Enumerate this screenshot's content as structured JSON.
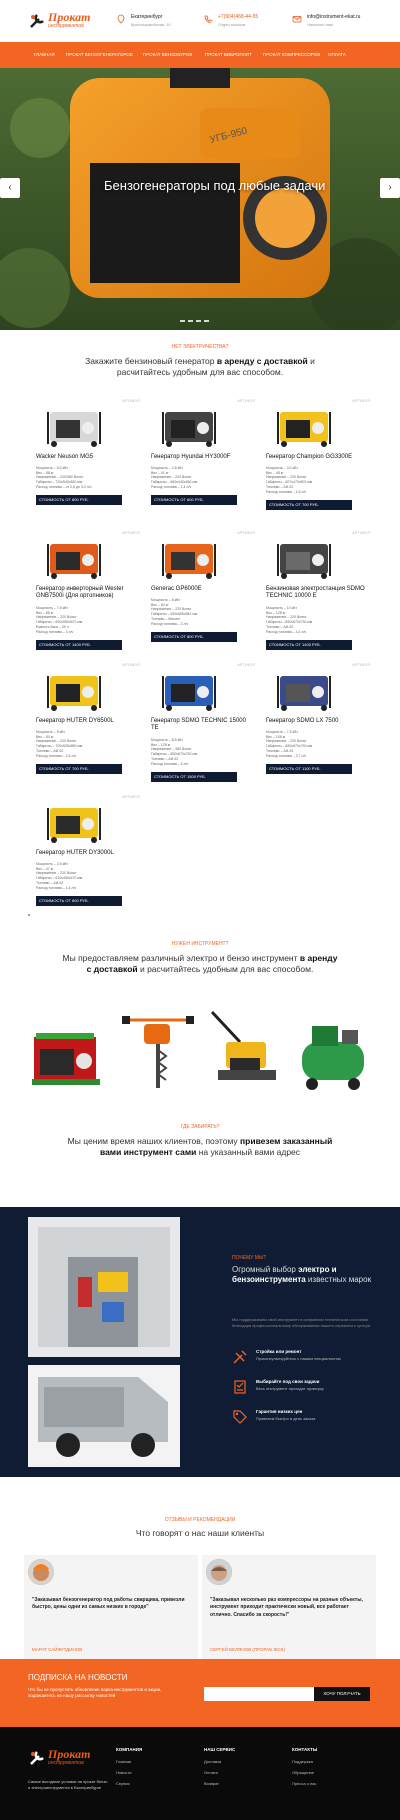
{
  "header": {
    "logo_title": "Прокат",
    "logo_subtitle": "инструментов",
    "address_city": "Екатеринбург",
    "address_street": "Красноармейская, 10",
    "phone": "+7(904)468-44-55",
    "phone_note": "Отдел заказов",
    "email": "info@instrument-ekat.ru",
    "email_note": "Написать нам"
  },
  "nav": [
    "Главная",
    "Прокат бензогенераторов",
    "Прокат бензобуров",
    "Прокат виброплит",
    "Прокат компрессоров",
    "Оплата"
  ],
  "hero": {
    "title": "Бензогенераторы под любые задачи",
    "slides": 4,
    "active_slide": 1,
    "prev_icon": "chevron-left-icon",
    "next_icon": "chevron-right-icon",
    "device_label": "УГБ-950"
  },
  "intro": {
    "eyebrow": "Нет электричества?",
    "title_pre": "Закажите бензиновый генератор ",
    "title_bold": "в аренду с доставкой",
    "title_post": " и расчитайтесь удобным для вас способом."
  },
  "cards": [
    {
      "brand": "АРТИКУЛ",
      "name": "Wacker Neuson MG5",
      "specs": "Мощность – 5,0 кВт\nВес – 88 кг\nНапряжение – 220/380 Вольт\nГабариты – 720x540x530 мм\nРасход топлива – от 2,6 до 3,0 л/ч",
      "price": "Стоимость от 800 руб."
    },
    {
      "brand": "АРТИКУЛ",
      "name": "Генератор Hyundai HY3000F",
      "specs": "Мощность – 2,8 кВт\nВес – 41 кг\nНапряжение – 220 Вольт\nГабариты – 560x440x450 мм\nРасход топлива – 1,4 л/ч",
      "price": "Стоимость от 600 руб."
    },
    {
      "brand": "АРТИКУЛ",
      "name": "Генератор Champion GG3300E",
      "specs": "Мощность – 3,0 кВт\nВес – 45 кг\nНапряжение – 220 Вольт\nГабариты – 607x470x502 мм\nТопливо – АИ-92\nРасход топлива – 1,5 л/ч",
      "price": "Стоимость от 700 руб."
    },
    {
      "brand": "АРТИКУЛ",
      "name": "Генератор инверторный Wester GNB7500i (Для ортопников)",
      "specs": "Мощность – 7,5 кВт\nВес – 86 кг\nНапряжение – 220 Вольт\nГабариты – 690x550x570 мм\nЁмкость бака – 25 л\nРасход топлива – 3 л/ч",
      "price": "Стоимость от 1400 руб."
    },
    {
      "brand": "АРТИКУЛ",
      "name": "Generac GP6000E",
      "specs": "Мощность – 6 кВт\nВес – 82 кг\nНапряжение – 220 Вольт\nГабариты – 690x556x581 мм\nТопливо – бензин\nРасход топлива – 3 л/ч",
      "price": "Стоимость от 800 руб."
    },
    {
      "brand": "АРТИКУЛ",
      "name": "Бензиновая электростанция SDMO TECHNIC 10000 E",
      "specs": "Мощность – 10 кВт\nВес – 128 кг\nНапряжение – 220 Вольт\nГабариты – 890x670x730 мм\nТопливо – АИ-92\nРасход топлива – 4,2 л/ч",
      "price": "Стоимость от 1400 руб."
    },
    {
      "brand": "АРТИКУЛ",
      "name": "Генератор HUTER DY6500L",
      "specs": "Мощность – 5 кВт\nВес – 80 кг\nНапряжение – 220 Вольт\nГабариты – 700x530x550 мм\nТопливо – АИ-92\nРасход топлива – 2,4 л/ч",
      "price": "Стоимость от 700 руб."
    },
    {
      "brand": "АРТИКУЛ",
      "name": "Генератор SDMO TECHNIC 15000 TE",
      "specs": "Мощность – 8,5 кВт\nВес – 128 кг\nНапряжение – 380 Вольт\nГабариты – 890x670x730 мм\nТопливо – АИ-92\nРасход топлива – 5 л/ч",
      "price": "Стоимость от 1500 руб."
    },
    {
      "brand": "АРТИКУЛ",
      "name": "Генератор SDMO LX 7500",
      "specs": "Мощность – 7,5 кВт\nВес – 108 кг\nНапряжение – 220 Вольт\nГабариты – 890x670x730 мм\nТопливо – АИ-92\nРасход топлива – 3,7 л/ч",
      "price": "Стоимость от 1100 руб."
    },
    {
      "brand": "АРТИКУЛ",
      "name": "Генератор HUTER DY3000L",
      "specs": "Мощность – 2,5 кВт\nВес – 47 кг\nНапряжение – 220 Вольт\nГабариты – 610x450x470 мм\nТопливо – АИ-92\nРасход топлива – 1,4 л/ч",
      "price": "Стоимость от 600 руб."
    }
  ],
  "tools_section": {
    "eyebrow": "Нужен инструмент?",
    "title_pre": "Мы предоставляем различный электро и бензо инструмент ",
    "title_bold": "в аренду с доставкой",
    "title_post": " и расчитайтесь удобным для вас способом."
  },
  "care_section": {
    "eyebrow": "Где забирать?",
    "title_pre": "Мы ценим время наших клиентов, поэтому ",
    "title_bold": "привезем заказанный вами инструмент сами",
    "title_post": " на указанный вами адрес"
  },
  "why": {
    "eyebrow": "Почему мы?",
    "title_pre": "Огромный выбор ",
    "title_bold": "электро и бензоинструмента",
    "title_post": " известных марок",
    "desc": "Мы поддерживаем свой инструмент в исправном техническом состоянии благодаря профессиональному обслуживанию нашего сервисного центра",
    "features": [
      {
        "icon": "repair-tools-icon",
        "title": "Стройка или ремонт",
        "desc": "Проконсультируйтесь с нашим специалистом"
      },
      {
        "icon": "checklist-icon",
        "title": "Выбирайте под свои задачи",
        "desc": "Весь инструмент проходит проверку"
      },
      {
        "icon": "price-tag-icon",
        "title": "Гарантия низких цен",
        "desc": "Привезем быстро в день заказа"
      }
    ]
  },
  "reviews": {
    "eyebrow": "Отзывы и рекомендации",
    "title": "Что говорят о нас наши клиенты",
    "items": [
      {
        "quote": "\"Заказывал бензогенератор под работы сварщика, привезли быстро, цены одни из самых низких в городе\"",
        "author": "Марат Сайфутдинов"
      },
      {
        "quote": "\"Заказывал несколько раз компрессоры на разные объекты, инструмент приходит практически новый, все работает отлично. Спасибо за скорость!\"",
        "author": "Сергей Белянов (прораб ЖСК)"
      }
    ]
  },
  "subscribe": {
    "title": "Подписка на новости",
    "desc": "Что бы не пропустить обновление парка инструментов и акции, подпишитесь на нашу рассылку новостей",
    "placeholder": "",
    "button": "Хочу получать"
  },
  "footer": {
    "logo_title": "Прокат",
    "logo_subtitle": "инструментов",
    "desc": "Самые выгодные условия на прокат бензо и электроинструмента в Екатеринбурге",
    "columns": [
      {
        "title": "Компания",
        "items": [
          "Главная",
          "Новости",
          "Сервис"
        ]
      },
      {
        "title": "Наш сервис",
        "items": [
          "Доставка",
          "Оплата",
          "Возврат"
        ]
      },
      {
        "title": "Контакты",
        "items": [
          "Поддержка",
          "Обращение",
          "Пресса о нас"
        ]
      }
    ]
  },
  "colors": {
    "accent": "#f26522",
    "dark": "#101c33",
    "price_bar": "#0f1b33",
    "footer": "#0a0a0a"
  }
}
